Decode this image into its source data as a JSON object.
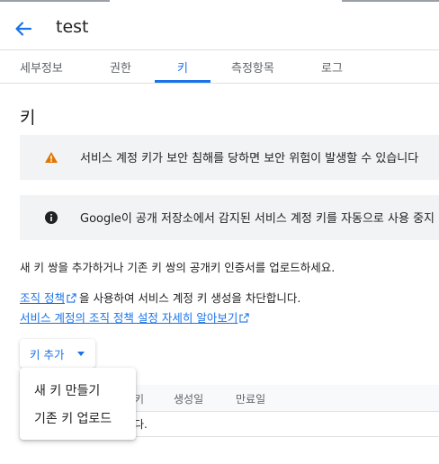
{
  "header": {
    "title": "test"
  },
  "tabs": [
    {
      "label": "세부정보"
    },
    {
      "label": "권한"
    },
    {
      "label": "키"
    },
    {
      "label": "측정항목"
    },
    {
      "label": "로그"
    }
  ],
  "section": {
    "title": "키"
  },
  "banners": {
    "warning": "서비스 계정 키가 보안 침해를 당하면 보안 위험이 발생할 수 있습니다",
    "info": "Google이 공개 저장소에서 감지된 서비스 계정 키를 자동으로 사용 중지"
  },
  "description": "새 키 쌍을 추가하거나 기존 키 쌍의 공개키 인증서를 업로드하세요.",
  "policy": {
    "link_text": "조직 정책",
    "suffix": "을 사용하여 서비스 계정 키 생성을 차단합니다.",
    "learn_more": "서비스 계정의 조직 정책 설정 자세히 알아보기"
  },
  "add_key": {
    "label": "키 추가"
  },
  "menu": {
    "create": "새 키 만들기",
    "upload": "기존 키 업로드"
  },
  "table": {
    "columns": [
      "키",
      "생성일",
      "만료일"
    ],
    "empty_tail": "다."
  },
  "colors": {
    "accent": "#1a73e8",
    "warning": "#e37400",
    "banner_bg": "#f1f3f4"
  }
}
